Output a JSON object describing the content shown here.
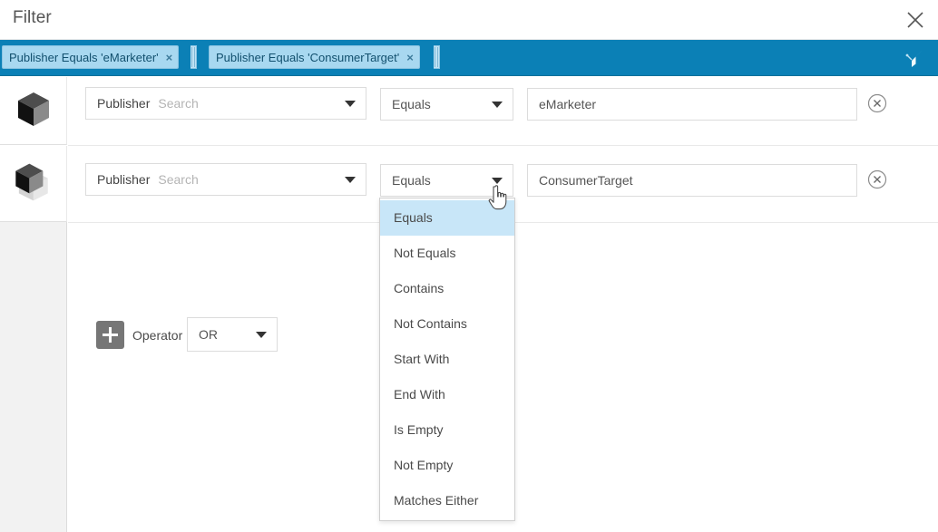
{
  "window": {
    "title": "Filter",
    "close_icon": "close-icon"
  },
  "chipbar": {
    "chips": [
      {
        "label": "Publisher Equals 'eMarketer'",
        "remove": "×"
      },
      {
        "label": "Publisher Equals 'ConsumerTarget'",
        "remove": "×"
      }
    ],
    "funnel_icon": "funnel-icon",
    "background_color": "#0b80b6",
    "chip_color": "#a8d8f0",
    "chip_text_color": "#12506e"
  },
  "rows": [
    {
      "drag_icon": "cube-icon",
      "field_label": "Publisher",
      "field_placeholder": "Search",
      "operator_value": "Equals",
      "value": "eMarketer",
      "remove_icon": "remove-circle-icon"
    },
    {
      "drag_icon": "cube-icon",
      "field_label": "Publisher",
      "field_placeholder": "Search",
      "operator_value": "Equals",
      "value": "ConsumerTarget",
      "remove_icon": "remove-circle-icon"
    }
  ],
  "operator_row": {
    "add_icon": "plus-icon",
    "label": "Operator",
    "value": "OR"
  },
  "dropdown": {
    "open": true,
    "selected": "Equals",
    "highlight_color": "#c8e6f8",
    "items": [
      "Equals",
      "Not Equals",
      "Contains",
      "Not Contains",
      "Start With",
      "End With",
      "Is Empty",
      "Not Empty",
      "Matches Either"
    ]
  },
  "cursor": {
    "type": "pointer-hand"
  }
}
